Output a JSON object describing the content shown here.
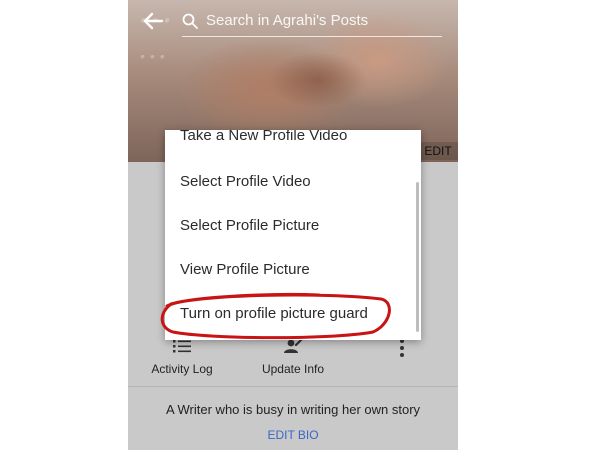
{
  "cover": {
    "script_line1": "...",
    "script_line2": "...",
    "edit_label": "EDIT"
  },
  "topbar": {
    "back_icon": "back-arrow-icon",
    "search_placeholder": "Search in Agrahi's Posts"
  },
  "menu": {
    "items": [
      {
        "label": "Take a New Profile Video"
      },
      {
        "label": "Select Profile Video"
      },
      {
        "label": "Select Profile Picture"
      },
      {
        "label": "View Profile Picture"
      },
      {
        "label": "Turn on profile picture guard"
      }
    ],
    "highlight_color": "#c81414"
  },
  "actions": [
    {
      "label": "Activity Log",
      "icon": "list-icon"
    },
    {
      "label": "Update Info",
      "icon": "edit-user-icon"
    },
    {
      "label": "",
      "icon": "more-vertical-icon"
    }
  ],
  "bio": {
    "text": "A Writer who is busy in writing her own story",
    "edit_label": "EDIT BIO",
    "edit_color": "#3b66c4"
  }
}
